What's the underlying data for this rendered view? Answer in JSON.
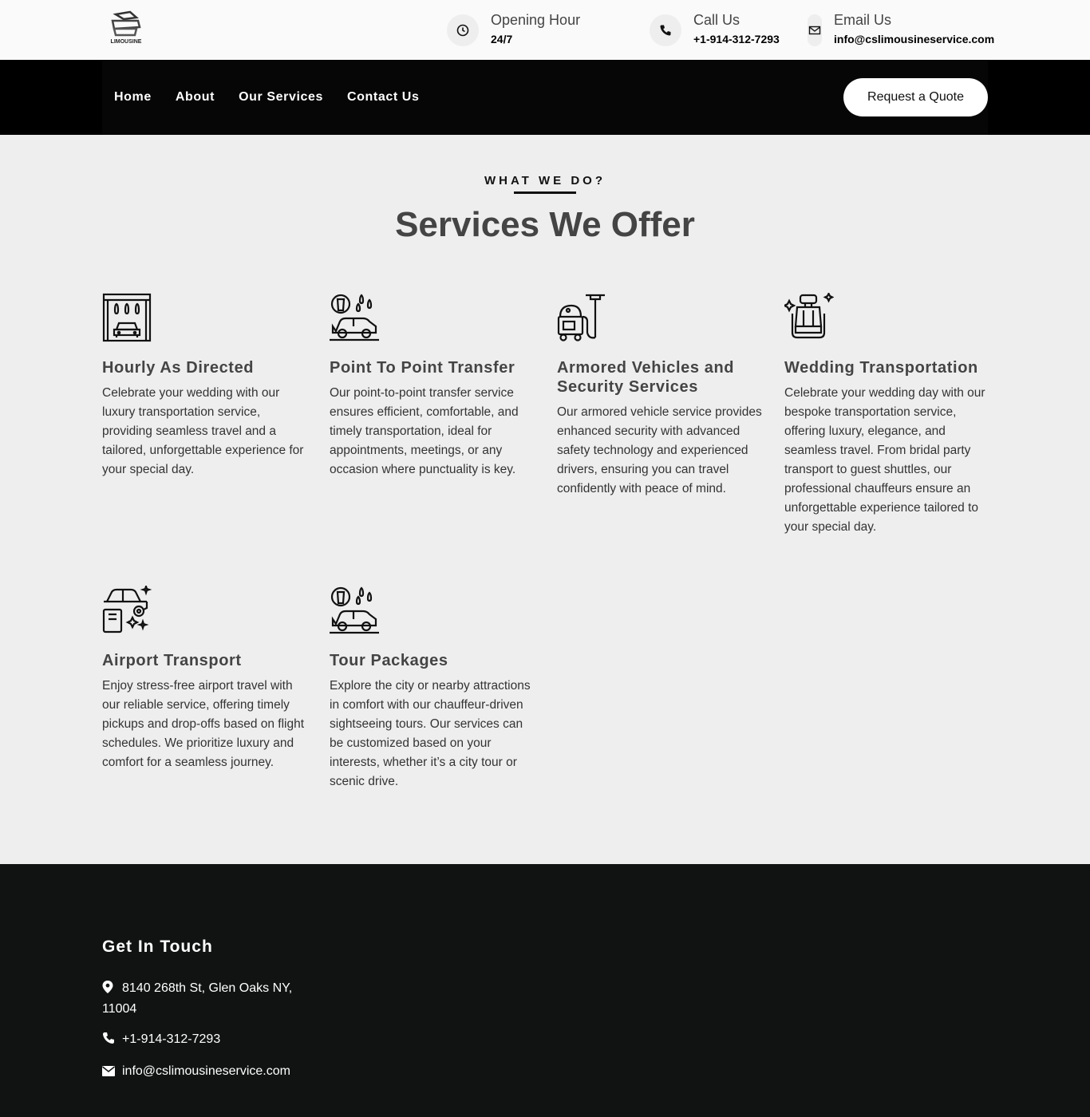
{
  "topbar": {
    "logo_icon": "limousine-car-logo",
    "logo_text": "LIMOUSINE",
    "hours": {
      "icon": "clock-icon",
      "label": "Opening Hour",
      "value": "24/7"
    },
    "call": {
      "icon": "phone-icon",
      "label": "Call Us",
      "value": "+1-914-312-7293"
    },
    "email": {
      "icon": "envelope-icon",
      "label": "Email Us",
      "value": "info@cslimousineservice.com"
    }
  },
  "nav": {
    "links": [
      "Home",
      "About",
      "Our Services",
      "Contact Us"
    ],
    "cta": "Request a Quote"
  },
  "services": {
    "eyebrow": "WHAT WE DO?",
    "title": "Services We Offer",
    "items": [
      {
        "icon": "car-wash-icon",
        "title": "Hourly As Directed",
        "text": "Celebrate your wedding with our luxury transportation service, providing seamless travel and a tailored, unforgettable experience for your special day."
      },
      {
        "icon": "car-cleaning-icon",
        "title": "Point To Point Transfer",
        "text": "Our point-to-point transfer service ensures efficient, comfortable, and timely transportation, ideal for appointments, meetings, or any occasion where punctuality is key."
      },
      {
        "icon": "vacuum-cleaner-icon",
        "title": "Armored Vehicles and Security Services",
        "text": "Our armored vehicle service provides enhanced security with advanced safety technology and experienced drivers, ensuring you can travel confidently with peace of mind."
      },
      {
        "icon": "car-seat-icon",
        "title": "Wedding Transportation",
        "text": "Celebrate your wedding day with our bespoke transportation service, offering luxury, elegance, and seamless travel. From bridal party transport to guest shuttles, our professional chauffeurs ensure an unforgettable experience tailored to your special day."
      },
      {
        "icon": "car-polish-icon",
        "title": "Airport Transport",
        "text": "Enjoy stress-free airport travel with our reliable service, offering timely pickups and drop-offs based on flight schedules. We prioritize luxury and comfort for a seamless journey."
      },
      {
        "icon": "car-cleaning-icon",
        "title": "Tour Packages",
        "text": "Explore the city or nearby attractions in comfort with our chauffeur-driven sightseeing tours. Our services can be customized based on your interests, whether it’s a city tour or scenic drive."
      }
    ]
  },
  "footer": {
    "title": "Get In Touch",
    "address": "8140 268th St, Glen Oaks NY, 11004",
    "phone": "+1-914-312-7293",
    "email": "info@cslimousineservice.com",
    "icons": [
      "map-marker-icon",
      "phone-icon",
      "envelope-icon"
    ]
  }
}
